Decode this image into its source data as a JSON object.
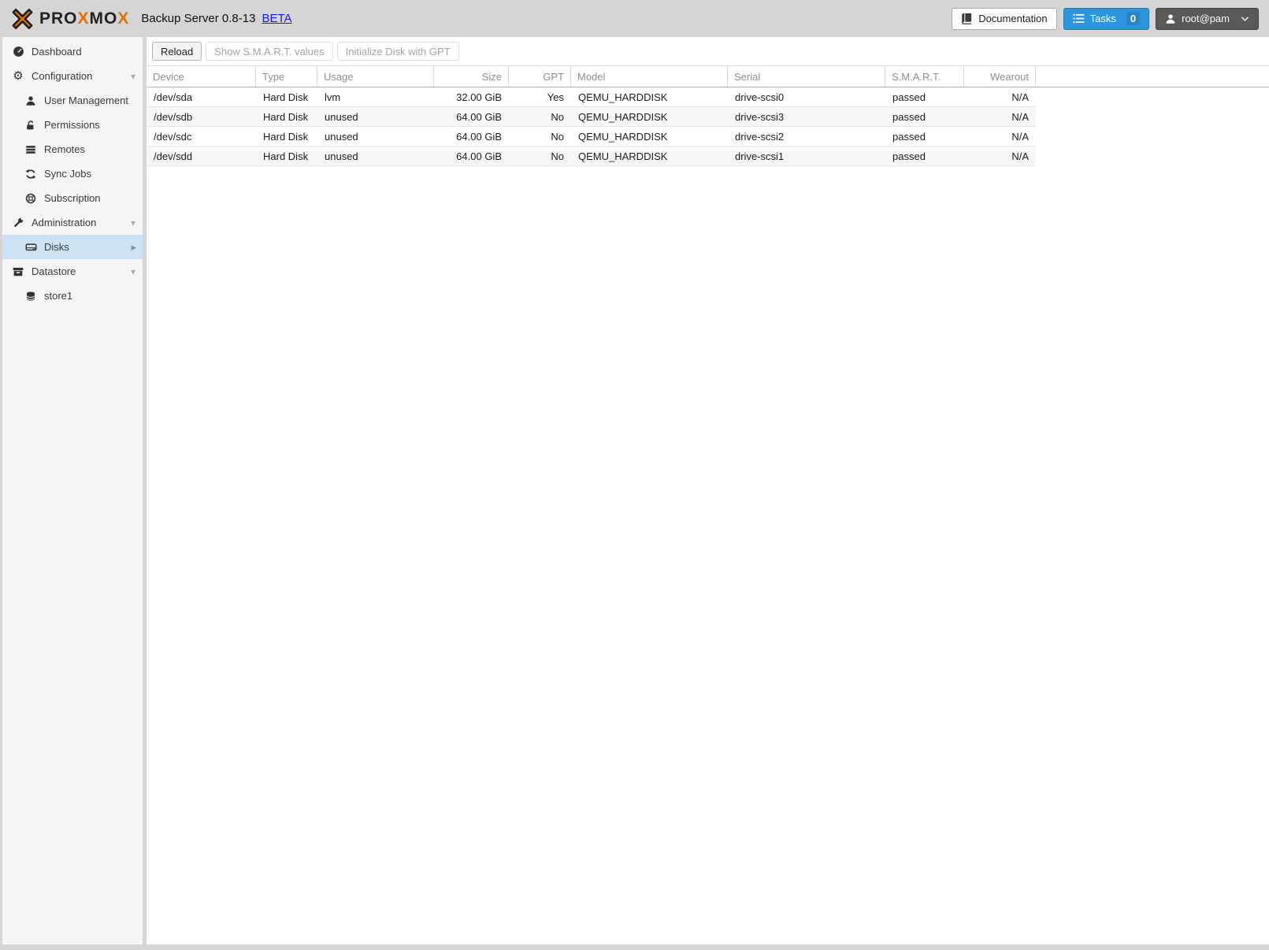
{
  "header": {
    "brand_segments": {
      "seg1": "PRO",
      "seg2": "X",
      "seg3": "MO",
      "seg4": "X"
    },
    "title": "Backup Server 0.8-13",
    "beta": "BETA",
    "documentation": "Documentation",
    "tasks": "Tasks",
    "tasks_count": "0",
    "user": "root@pam"
  },
  "sidebar": {
    "items": [
      {
        "label": "Dashboard",
        "icon": "dashboard-icon",
        "level": 0
      },
      {
        "label": "Configuration",
        "icon": "gears-icon",
        "level": 0,
        "expandable": true
      },
      {
        "label": "User Management",
        "icon": "user-icon",
        "level": 1
      },
      {
        "label": "Permissions",
        "icon": "unlock-icon",
        "level": 1
      },
      {
        "label": "Remotes",
        "icon": "remotes-icon",
        "level": 1
      },
      {
        "label": "Sync Jobs",
        "icon": "sync-icon",
        "level": 1
      },
      {
        "label": "Subscription",
        "icon": "lifering-icon",
        "level": 1
      },
      {
        "label": "Administration",
        "icon": "wrench-icon",
        "level": 0,
        "expandable": true
      },
      {
        "label": "Disks",
        "icon": "hdd-icon",
        "level": 1,
        "selected": true
      },
      {
        "label": "Datastore",
        "icon": "archive-icon",
        "level": 0,
        "expandable": true
      },
      {
        "label": "store1",
        "icon": "database-icon",
        "level": 1
      }
    ]
  },
  "toolbar": {
    "buttons": [
      {
        "label": "Reload",
        "enabled": true
      },
      {
        "label": "Show S.M.A.R.T. values",
        "enabled": false
      },
      {
        "label": "Initialize Disk with GPT",
        "enabled": false
      }
    ]
  },
  "table": {
    "columns": [
      "Device",
      "Type",
      "Usage",
      "Size",
      "GPT",
      "Model",
      "Serial",
      "S.M.A.R.T.",
      "Wearout"
    ],
    "rows": [
      [
        "/dev/sda",
        "Hard Disk",
        "lvm",
        "32.00 GiB",
        "Yes",
        "QEMU_HARDDISK",
        "drive-scsi0",
        "passed",
        "N/A"
      ],
      [
        "/dev/sdb",
        "Hard Disk",
        "unused",
        "64.00 GiB",
        "No",
        "QEMU_HARDDISK",
        "drive-scsi3",
        "passed",
        "N/A"
      ],
      [
        "/dev/sdc",
        "Hard Disk",
        "unused",
        "64.00 GiB",
        "No",
        "QEMU_HARDDISK",
        "drive-scsi2",
        "passed",
        "N/A"
      ],
      [
        "/dev/sdd",
        "Hard Disk",
        "unused",
        "64.00 GiB",
        "No",
        "QEMU_HARDDISK",
        "drive-scsi1",
        "passed",
        "N/A"
      ]
    ]
  },
  "colors": {
    "brand_orange": "#e57000",
    "accent_blue": "#2d95dc",
    "selected_nav_blue": "#cde2f4",
    "link_blue": "#1a1ae8",
    "smart_status": "passed"
  }
}
